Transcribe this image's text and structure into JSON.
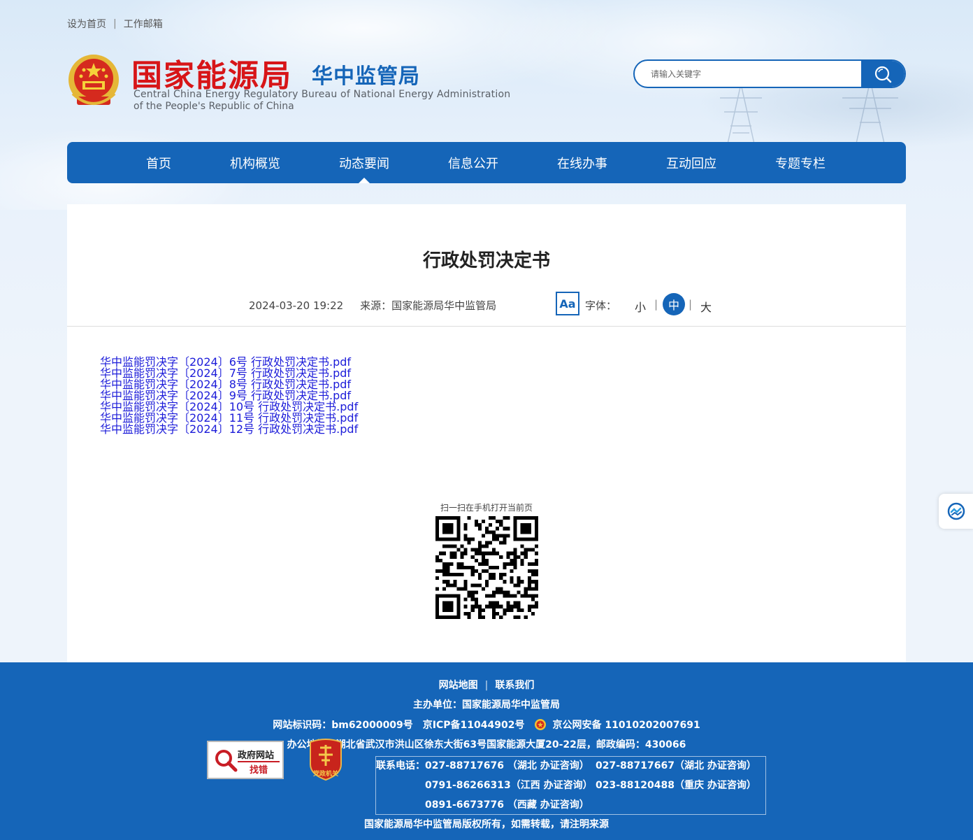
{
  "top_links": [
    "设为首页",
    "工作邮箱"
  ],
  "logo": {
    "name_cn": "国家能源局",
    "sub_cn": "华中监管局",
    "name_en_line1": "Central China Energy Regulatory Bureau of National Energy Administration",
    "name_en_line2": "of the People's Republic of China"
  },
  "search": {
    "placeholder": "请输入关键字"
  },
  "nav": {
    "items": [
      "首页",
      "机构概览",
      "动态要闻",
      "信息公开",
      "在线办事",
      "互动回应",
      "专题专栏"
    ],
    "active": "动态要闻"
  },
  "article": {
    "title": "行政处罚决定书",
    "date": "2024-03-20 19:22",
    "source": "来源：国家能源局华中监管局",
    "font_icon": "Aa",
    "font_label": "字体：",
    "font_small": "小",
    "font_medium": "中",
    "font_large": "大",
    "files": [
      "华中监能罚决字〔2024〕6号 行政处罚决定书.pdf",
      "华中监能罚决字〔2024〕7号 行政处罚决定书.pdf",
      "华中监能罚决字〔2024〕8号 行政处罚决定书.pdf",
      "华中监能罚决字〔2024〕9号 行政处罚决定书.pdf",
      "华中监能罚决字〔2024〕10号 行政处罚决定书.pdf",
      "华中监能罚决字〔2024〕11号 行政处罚决定书.pdf",
      "华中监能罚决字〔2024〕12号 行政处罚决定书.pdf"
    ],
    "qr_label": "扫一扫在手机打开当前页"
  },
  "footer": {
    "links": [
      "网站地图",
      "联系我们"
    ],
    "host": "主办单位：国家能源局华中监管局",
    "site_id": "网站标识码：bm62000009号",
    "icp": "京ICP备11044902号",
    "police": "京公网安备 11010202007691",
    "address": "办公地址：湖北省武汉市洪山区徐东大街63号国家能源大厦20-22层，邮政编码：430066",
    "contact_label": "联系电话：",
    "phones": [
      "027-88717676 （湖北 办证咨询）",
      "027-88717667（湖北 办证咨询）",
      "0791-86266313（江西 办证咨询）",
      "023-88120488（重庆 办证咨询）",
      "0891-6673776 （西藏 办证咨询）"
    ],
    "copyright": "国家能源局华中监管局版权所有，如需转载，请注明来源",
    "badge_gov_line1": "政府网站",
    "badge_gov_line2": "找错",
    "badge_party": "党政机关"
  },
  "colors": {
    "primary": "#1565b8",
    "logo_red": "#d71518",
    "link": "#1c1cd9"
  },
  "icons": [
    "national-emblem-icon",
    "search-icon",
    "float-service-icon",
    "police-emblem-icon",
    "magnifier-icon",
    "party-gov-icon"
  ]
}
